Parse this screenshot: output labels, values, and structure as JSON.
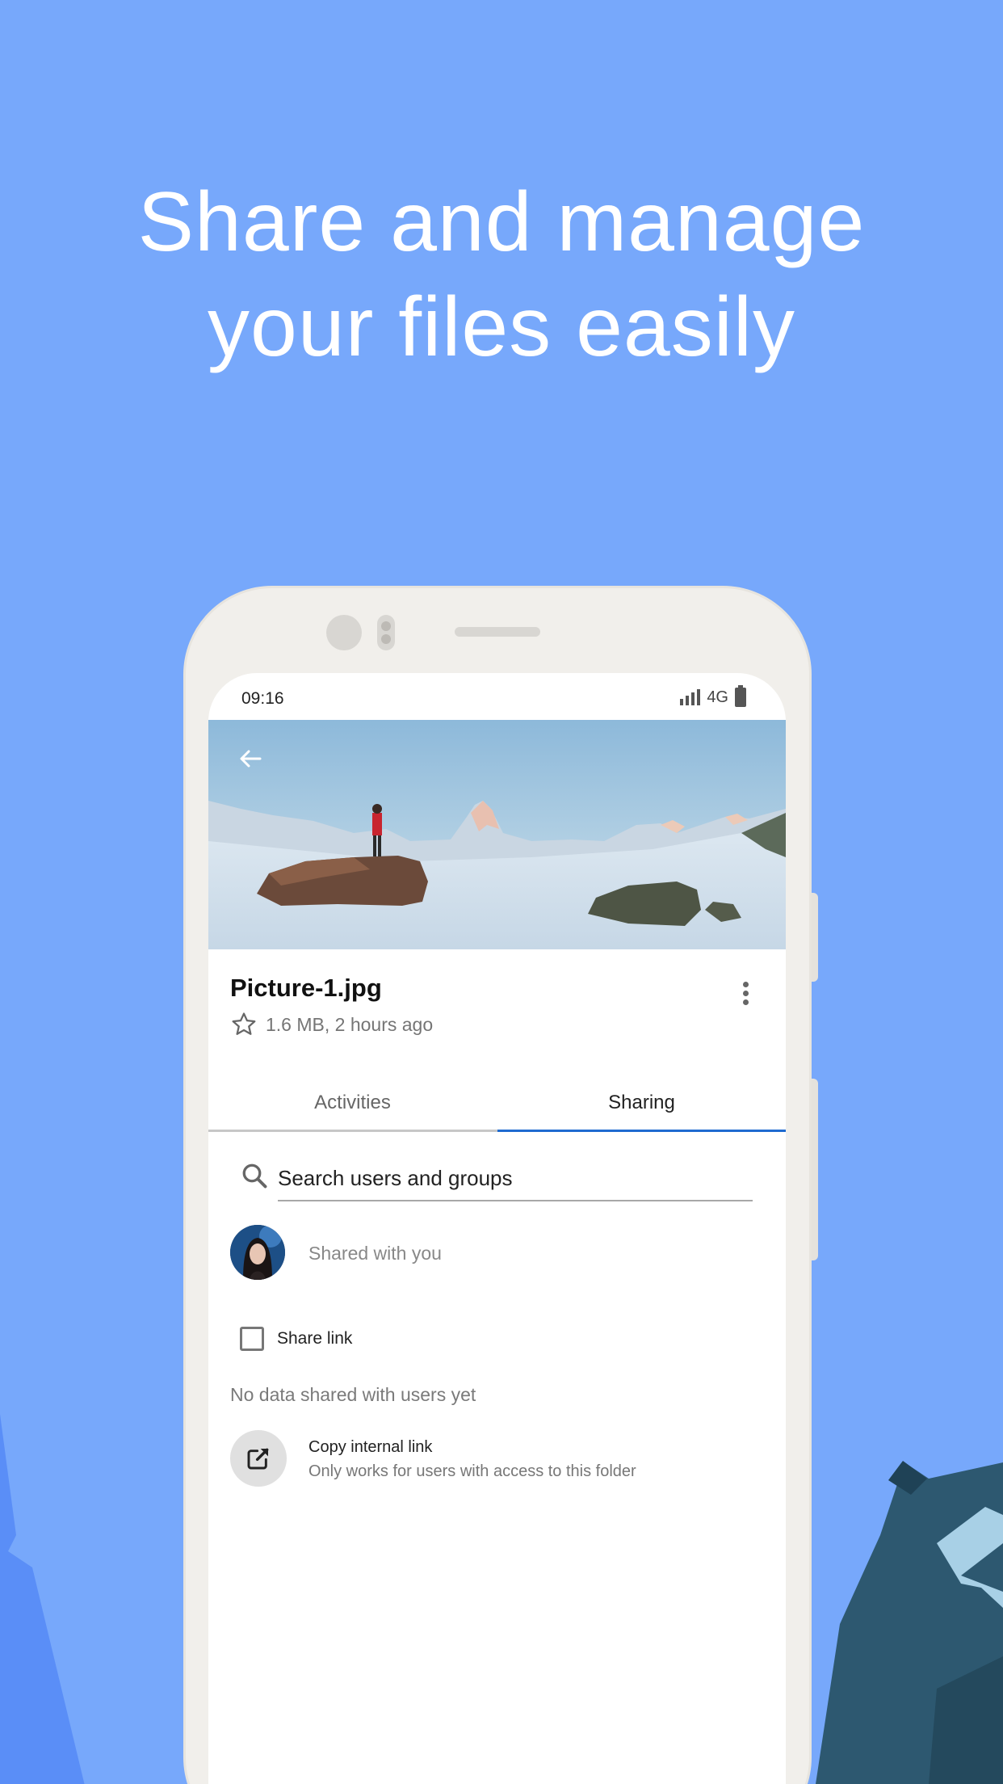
{
  "headline": {
    "line1": "Share and manage",
    "line2": "your files easily"
  },
  "colors": {
    "background": "#77a8fb",
    "accent": "#1f6bd0",
    "phone_frame": "#f1efeb",
    "mascot": "#2d5870"
  },
  "status_bar": {
    "time": "09:16",
    "network": "4G",
    "icons": [
      "signal-icon",
      "battery-icon"
    ]
  },
  "file": {
    "name": "Picture-1.jpg",
    "meta": "1.6 MB, 2 hours ago",
    "favorite_icon": "star-outline-icon"
  },
  "tabs": [
    {
      "label": "Activities",
      "active": false
    },
    {
      "label": "Sharing",
      "active": true
    }
  ],
  "search": {
    "placeholder": "Search users and groups"
  },
  "shared_with_you": {
    "label": "Shared with you"
  },
  "share_link": {
    "label": "Share link",
    "checked": false
  },
  "no_data_text": "No data shared with users yet",
  "copy_link": {
    "title": "Copy internal link",
    "subtitle": "Only works for users with access to this folder",
    "icon": "open-external-icon"
  }
}
